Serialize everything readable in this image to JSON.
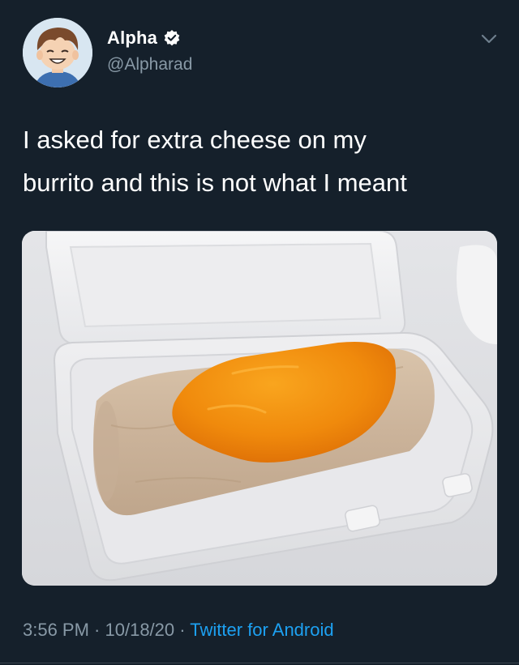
{
  "tweet": {
    "display_name": "Alpha",
    "handle": "@Alpharad",
    "verified": true,
    "text": "I asked for extra cheese on my\nburrito and this is not what I meant",
    "time": "3:56 PM",
    "separator": " · ",
    "date": "10/18/20",
    "source": "Twitter for Android"
  },
  "icons": {
    "verified": "verified-badge-icon",
    "menu": "chevron-down-icon"
  },
  "colors": {
    "background": "#15202b",
    "secondary_text": "#8899a6",
    "link": "#1da1f2",
    "cheese": "#f08a0c"
  }
}
